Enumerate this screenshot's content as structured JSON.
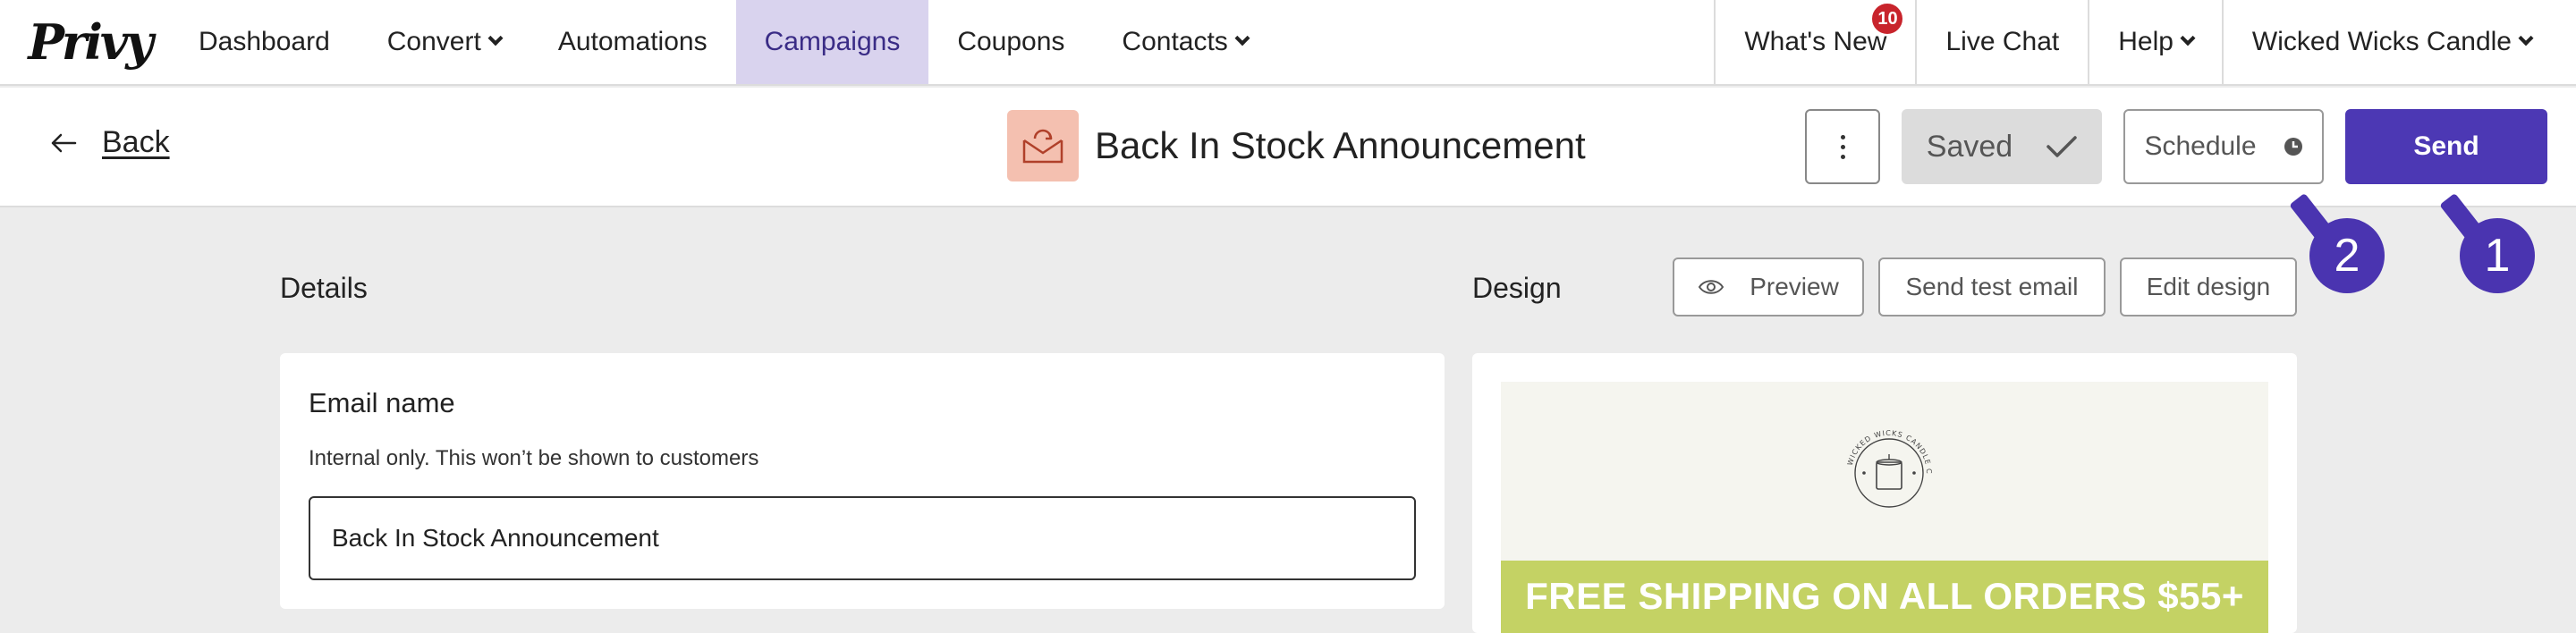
{
  "nav": {
    "logo": "Privy",
    "items": [
      {
        "label": "Dashboard"
      },
      {
        "label": "Convert"
      },
      {
        "label": "Automations"
      },
      {
        "label": "Campaigns"
      },
      {
        "label": "Coupons"
      },
      {
        "label": "Contacts"
      }
    ],
    "whats_new": "What's New",
    "whats_new_badge": "10",
    "live_chat": "Live Chat",
    "help": "Help",
    "account": "Wicked Wicks Candle"
  },
  "editor": {
    "back": "Back",
    "campaign_title": "Back In Stock Announcement",
    "saved": "Saved",
    "schedule": "Schedule",
    "send": "Send"
  },
  "callouts": [
    "2",
    "1"
  ],
  "details": {
    "title": "Details",
    "email_name_label": "Email name",
    "email_name_help": "Internal only. This won’t be shown to customers",
    "email_name_value": "Back In Stock Announcement"
  },
  "design": {
    "title": "Design",
    "preview": "Preview",
    "send_test": "Send test email",
    "edit_design": "Edit design",
    "logo_text": "WICKED WICKS CANDLE CO",
    "banner": "FREE SHIPPING ON ALL ORDERS $55+"
  },
  "colors": {
    "primary": "#4c38b4",
    "active_nav_bg": "#d9d3ee",
    "badge": "#c8242c",
    "banner": "#c4d264",
    "campaign_icon_bg": "#f4c0b0"
  }
}
